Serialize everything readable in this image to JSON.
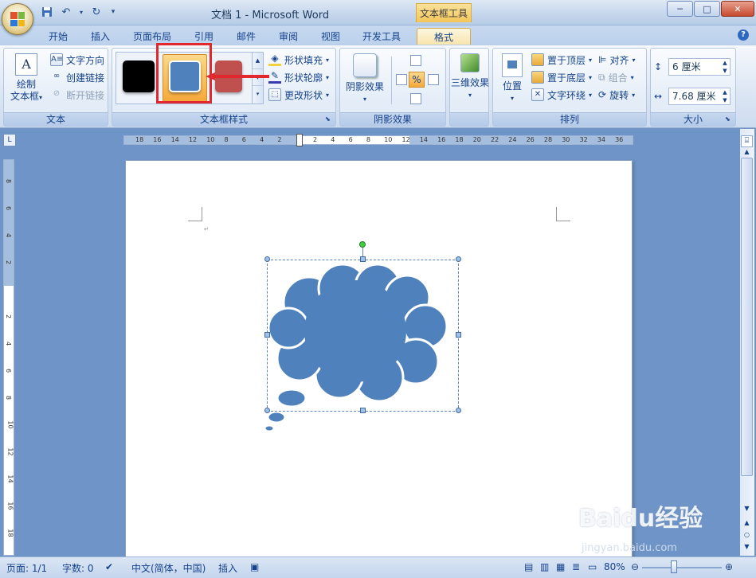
{
  "window": {
    "title": "文档 1 - Microsoft Word",
    "context_tab_title": "文本框工具",
    "controls": [
      "─",
      "□",
      "✕"
    ]
  },
  "qat": {
    "save": "save-icon",
    "undo": "undo-icon",
    "redo": "redo-icon",
    "customize": "▾"
  },
  "tabs": [
    "开始",
    "插入",
    "页面布局",
    "引用",
    "邮件",
    "审阅",
    "视图",
    "开发工具",
    "格式"
  ],
  "active_tab": "格式",
  "ribbon": {
    "text_group": {
      "label": "文本",
      "draw_textbox_line1": "绘制",
      "draw_textbox_line2": "文本框",
      "text_direction": "文字方向",
      "create_link": "创建链接",
      "break_link": "断开链接"
    },
    "textbox_styles": {
      "label": "文本框样式",
      "swatches": [
        "#000000",
        "#4f81bd",
        "#c0504d"
      ],
      "selected_index": 1,
      "shape_fill": "形状填充",
      "shape_outline": "形状轮廓",
      "change_shape": "更改形状"
    },
    "shadow": {
      "label": "阴影效果",
      "button": "阴影效果"
    },
    "threed": {
      "label": "",
      "button": "三维效果"
    },
    "arrange": {
      "label": "排列",
      "position": "位置",
      "bring_front": "置于顶层",
      "send_back": "置于底层",
      "text_wrap": "文字环绕",
      "align": "对齐",
      "group": "组合",
      "rotate": "旋转"
    },
    "size": {
      "label": "大小",
      "height": "6 厘米",
      "width": "7.68 厘米"
    }
  },
  "ruler": {
    "h_labels": [
      "18",
      "16",
      "14",
      "12",
      "10",
      "8",
      "6",
      "4",
      "2",
      "",
      "2",
      "4",
      "6",
      "8",
      "10",
      "12",
      "14",
      "16",
      "18",
      "20",
      "22",
      "24",
      "26",
      "28",
      "30",
      "32",
      "34",
      "36"
    ],
    "v_labels": [
      "8",
      "6",
      "4",
      "2",
      "",
      "2",
      "4",
      "6",
      "8",
      "10",
      "12",
      "14",
      "16",
      "18",
      "20"
    ]
  },
  "shape": {
    "fill": "#4f81bd",
    "type": "cloud-callout"
  },
  "status": {
    "page": "页面: 1/1",
    "words": "字数: 0",
    "language": "中文(简体，中国)",
    "mode": "插入",
    "zoom": "80%"
  },
  "watermark": {
    "brand": "Baidu经验",
    "url": "jingyan.baidu.com"
  }
}
